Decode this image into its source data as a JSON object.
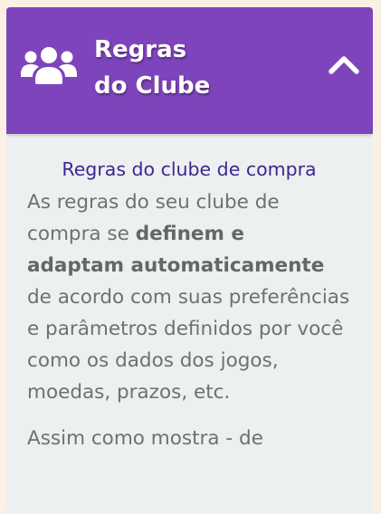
{
  "header": {
    "title_line1": "Regras",
    "title_line2": "do Clube",
    "group_icon": "users-group-icon",
    "toggle_icon": "chevron-up-icon",
    "accent_color": "#7e44bc"
  },
  "content": {
    "subtitle": "Regras do clube de compra",
    "paragraph1": {
      "text_a": "As regras do seu clube de compra se ",
      "bold_a": "definem e",
      "bold_b": "adaptam automaticamente",
      "text_b": " de acordo com suas preferências e parâmetros definidos por você como os dados dos jogos, moedas, prazos, etc."
    },
    "paragraph2": "Assim como mostra - de"
  }
}
